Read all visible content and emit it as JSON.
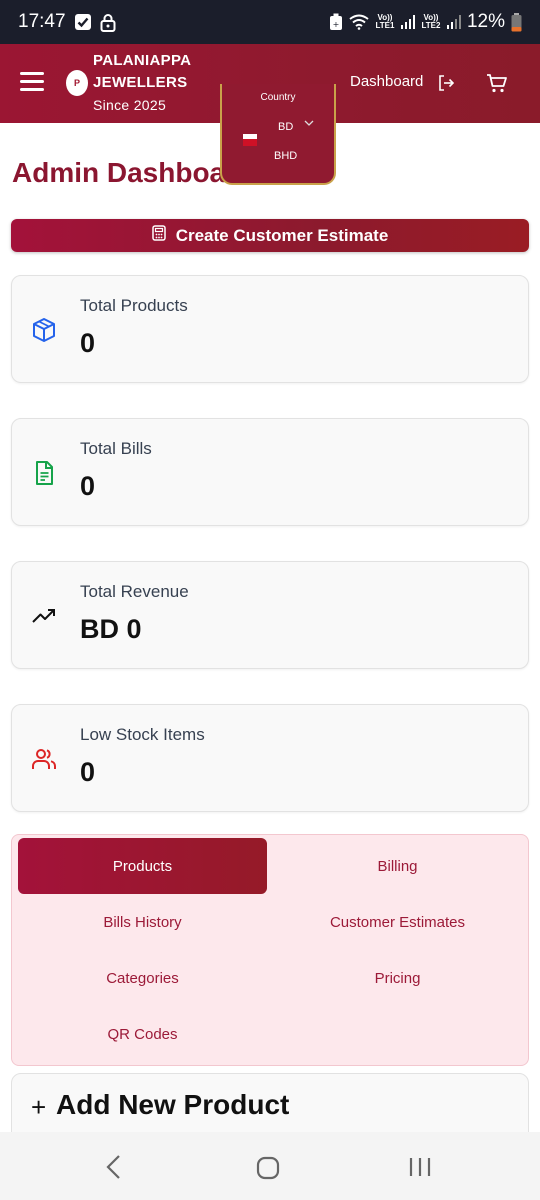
{
  "status_bar": {
    "time": "17:47",
    "battery": "12%",
    "sim1": "Vo)) LTE1",
    "sim2": "Vo)) LTE2"
  },
  "header": {
    "brand_line1": "PALANIAPPA",
    "brand_line2": "JEWELLERS",
    "brand_line3": "Since 2025",
    "logo_letter": "P",
    "country_label": "Country",
    "country_code": "BD",
    "currency_code": "BHD",
    "dashboard_link": "Dashboard"
  },
  "main": {
    "title": "Admin Dashboard",
    "estimate_button": "Create Customer Estimate",
    "stats": [
      {
        "label": "Total Products",
        "value": "0",
        "icon": "box-icon",
        "color": "#2563eb"
      },
      {
        "label": "Total Bills",
        "value": "0",
        "icon": "file-text-icon",
        "color": "#16a34a"
      },
      {
        "label": "Total Revenue",
        "value": "BD 0",
        "icon": "trending-up-icon",
        "color": "#111111"
      },
      {
        "label": "Low Stock Items",
        "value": "0",
        "icon": "users-icon",
        "color": "#dc2626"
      }
    ],
    "tabs": [
      {
        "label": "Products",
        "active": true
      },
      {
        "label": "Billing",
        "active": false
      },
      {
        "label": "Bills History",
        "active": false
      },
      {
        "label": "Customer Estimates",
        "active": false
      },
      {
        "label": "Categories",
        "active": false
      },
      {
        "label": "Pricing",
        "active": false
      },
      {
        "label": "QR Codes",
        "active": false
      }
    ],
    "add_product": {
      "plus": "+",
      "title": "Add New Product"
    }
  },
  "colors": {
    "brand": "#8b1630",
    "accent_gold": "#c9a24a",
    "tab_panel_bg": "#fde8ec"
  }
}
